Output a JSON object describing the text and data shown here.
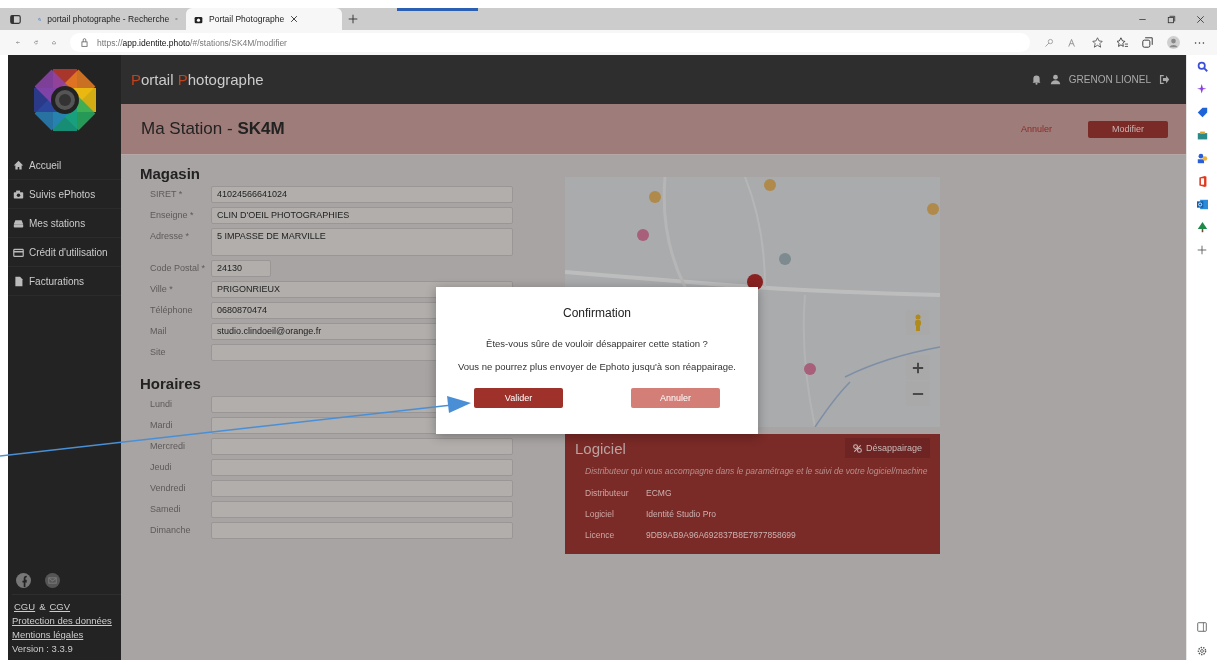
{
  "browser": {
    "tabs": [
      {
        "title": "portail photographe - Recherche",
        "selected": false
      },
      {
        "title": "Portail Photographe",
        "selected": true
      }
    ],
    "url": "https://**app.identite.photo**/#/stations/SK4M/modifier"
  },
  "app": {
    "brand": "Portail Photographe",
    "user": "GRENON LIONEL",
    "nav": [
      {
        "label": "Accueil"
      },
      {
        "label": "Suivis ePhotos"
      },
      {
        "label": "Mes stations"
      },
      {
        "label": "Crédit d'utilisation"
      },
      {
        "label": "Facturations"
      }
    ],
    "footer": {
      "cgu": "CGU",
      "and": "&",
      "cgv": "CGV",
      "links": [
        "Protection des données",
        "Mentions légales"
      ],
      "version": "Version : 3.3.9"
    }
  },
  "page": {
    "title": "Ma Station - **SK4M**",
    "cancel": "Annuler",
    "submit": "Modifier",
    "sections": [
      {
        "title": "Magasin",
        "fields": [
          {
            "label": "SIRET *",
            "value": "41024566641024",
            "kind": "text"
          },
          {
            "label": "Enseigne *",
            "value": "CLIN D'OEIL PHOTOGRAPHIES",
            "kind": "text"
          },
          {
            "label": "Adresse *",
            "value": "5 IMPASSE DE MARVILLE",
            "kind": "textarea"
          },
          {
            "label": "Code Postal *",
            "value": "24130",
            "kind": "short"
          },
          {
            "label": "Ville *",
            "value": "PRIGONRIEUX",
            "kind": "text"
          },
          {
            "label": "Téléphone",
            "value": "0680870474",
            "kind": "text"
          },
          {
            "label": "Mail",
            "value": "studio.clindoeil@orange.fr",
            "kind": "text"
          },
          {
            "label": "Site",
            "kind": "text"
          }
        ]
      },
      {
        "title": "Horaires",
        "fields": [
          {
            "label": "Lundi",
            "kind": "text"
          },
          {
            "label": "Mardi",
            "kind": "text"
          },
          {
            "label": "Mercredi",
            "kind": "text"
          },
          {
            "label": "Jeudi",
            "kind": "text"
          },
          {
            "label": "Vendredi",
            "kind": "text"
          },
          {
            "label": "Samedi",
            "kind": "text"
          },
          {
            "label": "Dimanche",
            "kind": "text"
          }
        ]
      }
    ],
    "software": {
      "title": "Logiciel",
      "button": "Désappairage",
      "description": "Distributeur qui vous accompagne dans le paramétrage et le suivi de votre logiciel/machine",
      "rows": [
        {
          "label": "Distributeur",
          "value": "ECMG"
        },
        {
          "label": "Logiciel",
          "value": "Identité Studio Pro"
        },
        {
          "label": "Licence",
          "value": "9DB9AB9A96A692837B8E7877858699"
        }
      ]
    }
  },
  "modal": {
    "title": "Confirmation",
    "messages": [
      "Êtes-vous sûre de vouloir désappairer cette station ?",
      "Vous ne pourrez plus envoyer de Ephoto jusqu'à son réappairage."
    ],
    "confirm": "Valider",
    "cancel": "Annuler"
  }
}
